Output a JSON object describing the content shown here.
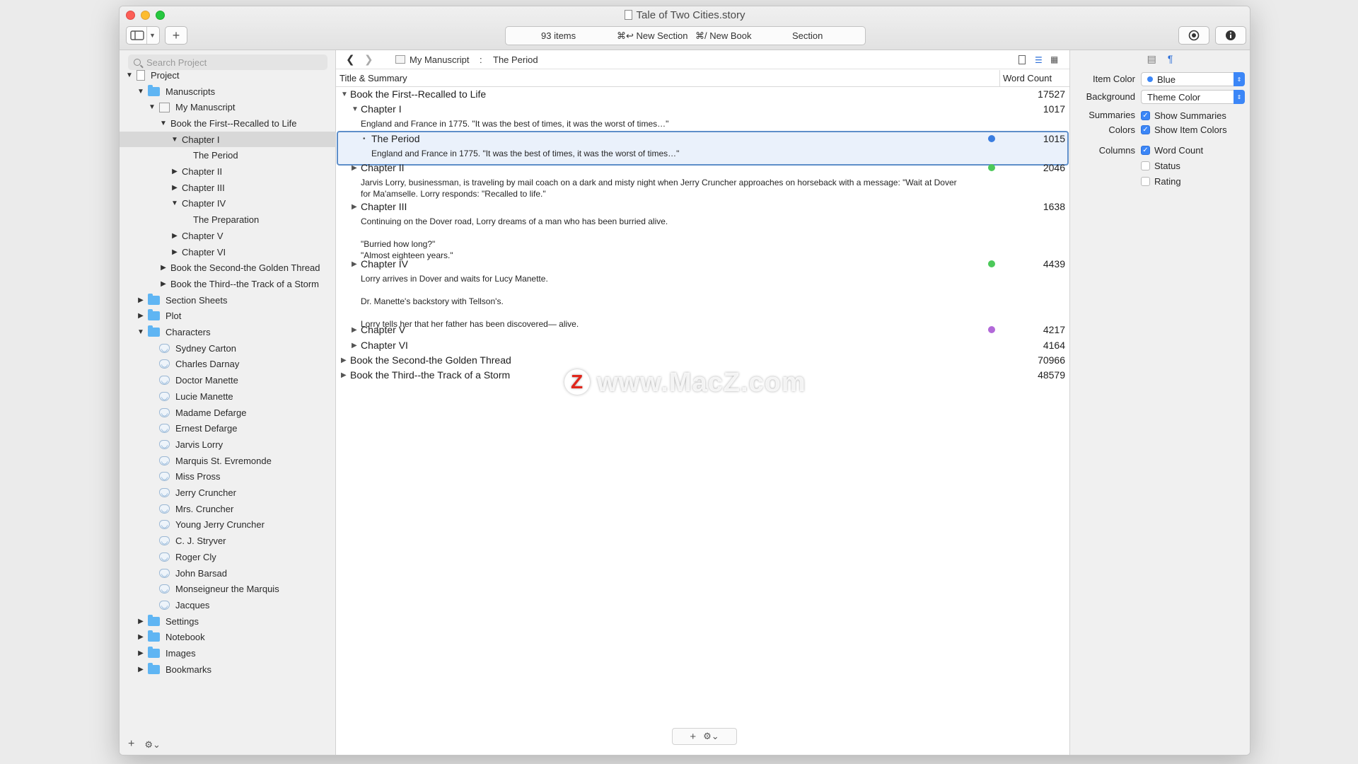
{
  "window": {
    "title": "Tale of Two Cities.story"
  },
  "toolbar": {
    "activity": {
      "items": "93 items",
      "new_section": "⌘↩ New Section",
      "new_book": "⌘/ New Book",
      "mode": "Section"
    }
  },
  "sidebar": {
    "search_placeholder": "Search Project",
    "tree": [
      {
        "label": "Project",
        "depth": 0,
        "disclosure": "▼",
        "icon": "page-icon"
      },
      {
        "label": "Manuscripts",
        "depth": 1,
        "disclosure": "▼",
        "icon": "folder-icon"
      },
      {
        "label": "My Manuscript",
        "depth": 2,
        "disclosure": "▼",
        "icon": "manuscript-icon"
      },
      {
        "label": "Book the First--Recalled to Life",
        "depth": 3,
        "disclosure": "▼",
        "icon": ""
      },
      {
        "label": "Chapter I",
        "depth": 4,
        "disclosure": "▼",
        "icon": "",
        "selected": true
      },
      {
        "label": "The Period",
        "depth": 5,
        "disclosure": "",
        "icon": ""
      },
      {
        "label": "Chapter II",
        "depth": 4,
        "disclosure": "▶",
        "icon": ""
      },
      {
        "label": "Chapter III",
        "depth": 4,
        "disclosure": "▶",
        "icon": ""
      },
      {
        "label": "Chapter IV",
        "depth": 4,
        "disclosure": "▼",
        "icon": ""
      },
      {
        "label": "The Preparation",
        "depth": 5,
        "disclosure": "",
        "icon": ""
      },
      {
        "label": "Chapter V",
        "depth": 4,
        "disclosure": "▶",
        "icon": ""
      },
      {
        "label": "Chapter VI",
        "depth": 4,
        "disclosure": "▶",
        "icon": ""
      },
      {
        "label": "Book the Second-the Golden Thread",
        "depth": 3,
        "disclosure": "▶",
        "icon": ""
      },
      {
        "label": "Book the Third--the Track of a Storm",
        "depth": 3,
        "disclosure": "▶",
        "icon": ""
      },
      {
        "label": "Section Sheets",
        "depth": 1,
        "disclosure": "▶",
        "icon": "folder-icon"
      },
      {
        "label": "Plot",
        "depth": 1,
        "disclosure": "▶",
        "icon": "folder-icon"
      },
      {
        "label": "Characters",
        "depth": 1,
        "disclosure": "▼",
        "icon": "folder-icon"
      },
      {
        "label": "Sydney Carton",
        "depth": 2,
        "disclosure": "",
        "icon": "mask-icon"
      },
      {
        "label": "Charles Darnay",
        "depth": 2,
        "disclosure": "",
        "icon": "mask-icon"
      },
      {
        "label": "Doctor Manette",
        "depth": 2,
        "disclosure": "",
        "icon": "mask-icon"
      },
      {
        "label": "Lucie Manette",
        "depth": 2,
        "disclosure": "",
        "icon": "mask-icon"
      },
      {
        "label": "Madame Defarge",
        "depth": 2,
        "disclosure": "",
        "icon": "mask-icon"
      },
      {
        "label": "Ernest Defarge",
        "depth": 2,
        "disclosure": "",
        "icon": "mask-icon"
      },
      {
        "label": "Jarvis Lorry",
        "depth": 2,
        "disclosure": "",
        "icon": "mask-icon"
      },
      {
        "label": "Marquis St. Evremonde",
        "depth": 2,
        "disclosure": "",
        "icon": "mask-icon"
      },
      {
        "label": "Miss Pross",
        "depth": 2,
        "disclosure": "",
        "icon": "mask-icon"
      },
      {
        "label": "Jerry Cruncher",
        "depth": 2,
        "disclosure": "",
        "icon": "mask-icon"
      },
      {
        "label": "Mrs. Cruncher",
        "depth": 2,
        "disclosure": "",
        "icon": "mask-icon"
      },
      {
        "label": "Young Jerry Cruncher",
        "depth": 2,
        "disclosure": "",
        "icon": "mask-icon"
      },
      {
        "label": "C. J. Stryver",
        "depth": 2,
        "disclosure": "",
        "icon": "mask-icon"
      },
      {
        "label": "Roger Cly",
        "depth": 2,
        "disclosure": "",
        "icon": "mask-icon"
      },
      {
        "label": "John Barsad",
        "depth": 2,
        "disclosure": "",
        "icon": "mask-icon"
      },
      {
        "label": "Monseigneur the Marquis",
        "depth": 2,
        "disclosure": "",
        "icon": "mask-icon"
      },
      {
        "label": "Jacques",
        "depth": 2,
        "disclosure": "",
        "icon": "mask-icon"
      },
      {
        "label": "Settings",
        "depth": 1,
        "disclosure": "▶",
        "icon": "folder-icon"
      },
      {
        "label": "Notebook",
        "depth": 1,
        "disclosure": "▶",
        "icon": "folder-icon"
      },
      {
        "label": "Images",
        "depth": 1,
        "disclosure": "▶",
        "icon": "folder-icon"
      },
      {
        "label": "Bookmarks",
        "depth": 1,
        "disclosure": "▶",
        "icon": "folder-icon"
      }
    ],
    "footer": {
      "add": "+",
      "gear": "⚙︎⌄"
    }
  },
  "main": {
    "breadcrumb": {
      "manuscript": "My Manuscript",
      "separator": ":",
      "current": "The Period"
    },
    "columns": {
      "title": "Title & Summary",
      "word_count": "Word Count"
    },
    "rows": [
      {
        "title": "Book the First--Recalled to Life",
        "disclosure": "▼",
        "count": "17527",
        "summary": "",
        "dot": "",
        "level": 0
      },
      {
        "title": "Chapter I",
        "disclosure": "▼",
        "count": "1017",
        "summary": "England and France in 1775. \"It was the best of times, it was the worst of times…\"",
        "dot": "",
        "level": 1
      },
      {
        "title": "The Period",
        "disclosure": "•",
        "count": "1015",
        "summary": "England and France in 1775. \"It was the best of times, it was the worst of times…\"",
        "dot": "#3a7de0",
        "level": 2,
        "selected": true
      },
      {
        "title": "Chapter II",
        "disclosure": "▶",
        "count": "2046",
        "summary": "Jarvis Lorry, businessman, is traveling by mail coach on a dark and misty night when Jerry Cruncher approaches on horseback with a message: \"Wait at Dover\nfor Ma'amselle. Lorry responds: \"Recalled to life.\"",
        "dot": "#4cc95a",
        "level": 1
      },
      {
        "title": "Chapter III",
        "disclosure": "▶",
        "count": "1638",
        "summary": "Continuing on the Dover road, Lorry dreams of a man who has been burried alive.\n\n\"Burried how long?\"\n\"Almost eighteen years.\"",
        "dot": "",
        "level": 1
      },
      {
        "title": "Chapter IV",
        "disclosure": "▶",
        "count": "4439",
        "summary": "Lorry arrives in Dover and waits for Lucy Manette.\n\nDr. Manette's backstory with Tellson's.\n\nLorry tells her that her father has been discovered— alive.",
        "dot": "#4cc95a",
        "level": 1
      },
      {
        "title": "Chapter V",
        "disclosure": "▶",
        "count": "4217",
        "summary": "",
        "dot": "#b269d9",
        "level": 1
      },
      {
        "title": "Chapter VI",
        "disclosure": "▶",
        "count": "4164",
        "summary": "",
        "dot": "",
        "level": 1
      },
      {
        "title": "Book the Second-the Golden Thread",
        "disclosure": "▶",
        "count": "70966",
        "summary": "",
        "dot": "",
        "level": 0
      },
      {
        "title": "Book the Third--the Track of a Storm",
        "disclosure": "▶",
        "count": "48579",
        "summary": "",
        "dot": "",
        "level": 0
      }
    ]
  },
  "inspector": {
    "item_color_label": "Item Color",
    "item_color_value": "Blue",
    "background_label": "Background",
    "background_value": "Theme Color",
    "summaries_label": "Summaries",
    "show_summaries": "Show Summaries",
    "colors_label": "Colors",
    "show_item_colors": "Show Item Colors",
    "columns_label": "Columns",
    "word_count": "Word Count",
    "status": "Status",
    "rating": "Rating"
  },
  "watermark": {
    "text": "www.MacZ.com",
    "logo": "Z"
  }
}
